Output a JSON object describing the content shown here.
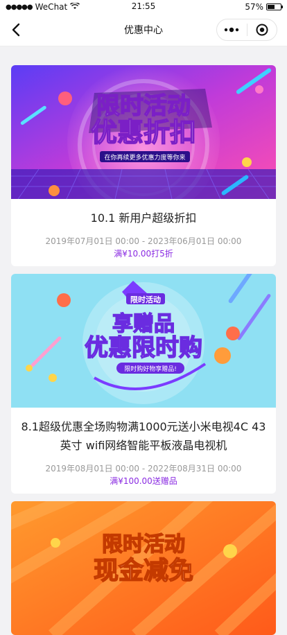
{
  "status_bar": {
    "carrier": "WeChat",
    "time": "21:55",
    "battery": "57%"
  },
  "nav": {
    "title": "优惠中心"
  },
  "coupons": [
    {
      "banner_line1": "限时活动",
      "banner_line2": "优惠折扣",
      "banner_tag": "在你再续更多优惠力度等你来",
      "title": "10.1 新用户超级折扣",
      "period": "2019年07月01日 00:00 - 2023年06月01日 00:00",
      "rule": "满¥10.00打5折"
    },
    {
      "banner_badge": "限时活动",
      "banner_line1": "享赠品",
      "banner_line2": "优惠限时购",
      "banner_tag": "限时购好物享赠品!",
      "title": "8.1超级优惠全场购物满1000元送小米电视4C 43英寸 wifi网络智能平板液晶电视机",
      "period": "2019年08月01日 00:00 - 2022年08月31日 00:00",
      "rule": "满¥100.00送赠品"
    },
    {
      "banner_line1": "限时活动",
      "banner_line2": "现金减免"
    }
  ],
  "colors": {
    "accent": "#8a2be2",
    "banner1": "#7b2ff7",
    "banner2": "#8fe0f3",
    "banner3": "#ff7a1a"
  }
}
